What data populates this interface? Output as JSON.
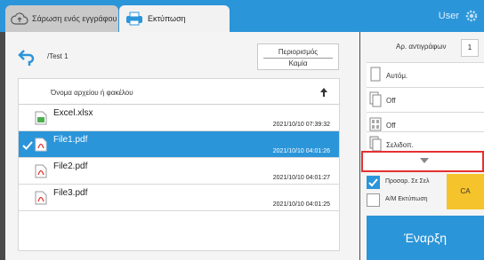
{
  "tabs": [
    {
      "label": "Σάρωση ενός εγγράφου",
      "icon": "cloud-upload-icon"
    },
    {
      "label": "Εκτύπωση",
      "icon": "printer-icon"
    }
  ],
  "header": {
    "user": "User",
    "settings_icon": "gear-icon"
  },
  "toolbar": {
    "path": "/Test 1",
    "restriction_label": "Περιορισμός",
    "restriction_value": "Καμία"
  },
  "file_list": {
    "column_header": "Όνομα αρχείου ή φακέλου",
    "rows": [
      {
        "name": "Excel.xlsx",
        "date": "2021/10/10 07:39:32",
        "type": "xlsx",
        "selected": false
      },
      {
        "name": "File1.pdf",
        "date": "2021/10/10 04:01:26",
        "type": "pdf",
        "selected": true
      },
      {
        "name": "File2.pdf",
        "date": "2021/10/10 04:01:27",
        "type": "pdf",
        "selected": false
      },
      {
        "name": "File3.pdf",
        "date": "2021/10/10 04:01:25",
        "type": "pdf",
        "selected": false
      }
    ]
  },
  "settings": {
    "copies_label": "Αρ. αντιγράφων",
    "copies_value": "1",
    "options": [
      {
        "text": "Αυτόμ.",
        "icon": "paper-size-icon"
      },
      {
        "text": "Off",
        "icon": "duplex-icon"
      },
      {
        "text": "Off",
        "icon": "n-up-icon"
      },
      {
        "text": "Σελιδοπ.",
        "icon": "collate-icon"
      }
    ],
    "fit_to_page": "Προσαρ. Σε Σελ",
    "bw_print": "Α/Μ Εκτύπωση",
    "ca_label": "CA",
    "start_label": "Έναρξη"
  },
  "colors": {
    "accent": "#2b95d9",
    "highlight": "#e53030",
    "ca": "#f5c32b"
  }
}
